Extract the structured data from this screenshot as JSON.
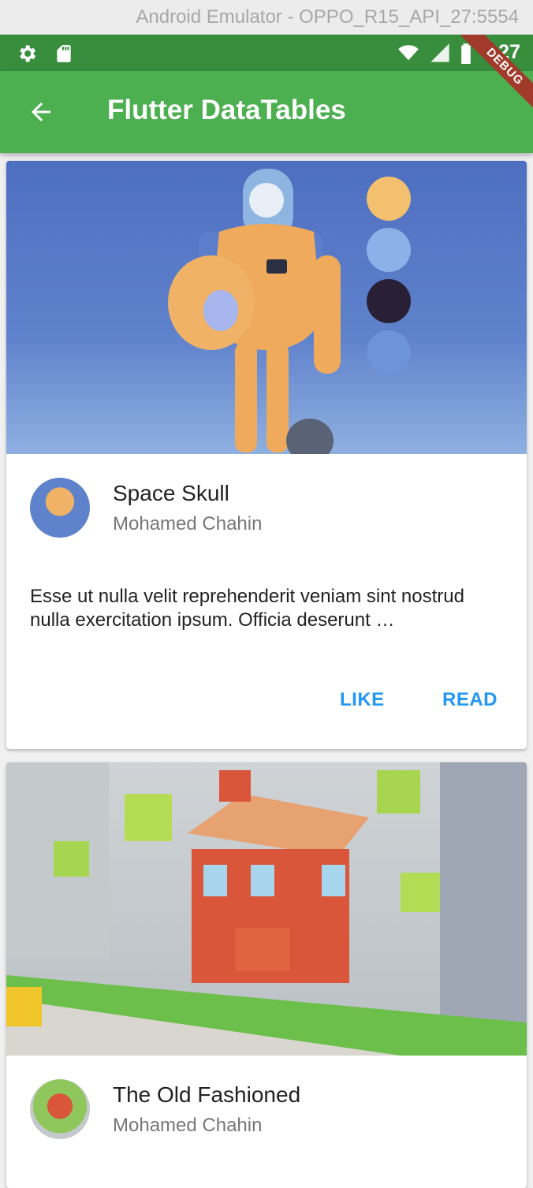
{
  "emulator": {
    "title": "Android Emulator - OPPO_R15_API_27:5554"
  },
  "status_bar": {
    "time": "3:27"
  },
  "app_bar": {
    "title": "Flutter DataTables"
  },
  "debug_banner": "DEBUG",
  "cards": [
    {
      "title": "Space Skull",
      "author": "Mohamed Chahin",
      "body": "Esse ut nulla velit reprehenderit veniam sint nostrud nulla exercitation ipsum. Officia deserunt …",
      "like_label": "LIKE",
      "read_label": "READ"
    },
    {
      "title": "The Old Fashioned",
      "author": "Mohamed Chahin"
    }
  ],
  "colors": {
    "status_bar": "#388e3c",
    "app_bar": "#4caf50",
    "accent": "#2196f3"
  }
}
